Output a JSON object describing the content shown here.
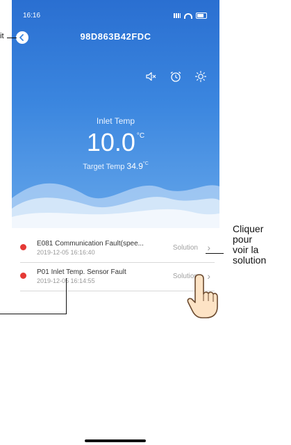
{
  "status_bar": {
    "time": "16:16"
  },
  "header": {
    "device_id": "98D863B42FDC"
  },
  "temperature": {
    "label": "Inlet Temp",
    "value": "10.0",
    "unit": "°C",
    "target_label": "Target Temp",
    "target_value": "34.9",
    "target_unit": "°C"
  },
  "faults": [
    {
      "title": "E081 Communication Fault(spee...",
      "time": "2019-12-05 16:16:40",
      "solution_label": "Solution"
    },
    {
      "title": "P01 Inlet Temp. Sensor Fault",
      "time": "2019-12-05 16:14:55",
      "solution_label": "Solution"
    }
  ],
  "annotations": {
    "left_top": "it",
    "right_callout": [
      "Cliquer",
      "pour",
      "voir la",
      "solution"
    ]
  },
  "colors": {
    "accent": "#3b86df",
    "fault_dot": "#e53935"
  },
  "icons": [
    "back-icon",
    "mute-icon",
    "alarm-clock-icon",
    "brightness-icon",
    "chevron-right-icon",
    "pointing-hand-icon"
  ]
}
